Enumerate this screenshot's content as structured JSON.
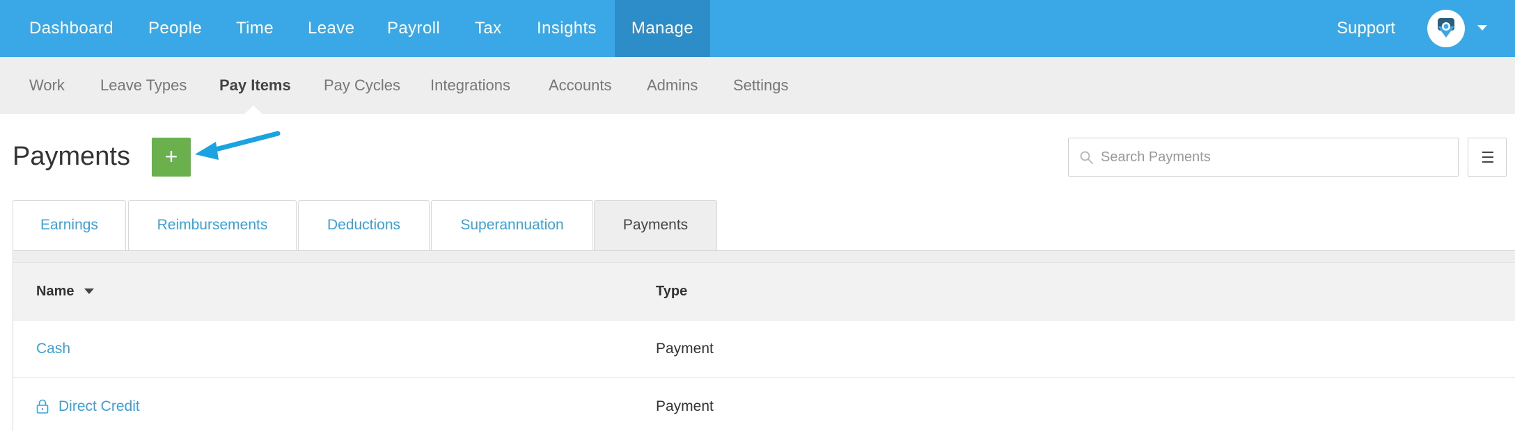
{
  "topnav": {
    "items": [
      "Dashboard",
      "People",
      "Time",
      "Leave",
      "Payroll",
      "Tax",
      "Insights",
      "Manage"
    ],
    "active": "Manage",
    "support": "Support"
  },
  "subnav": {
    "items": [
      "Work",
      "Leave Types",
      "Pay Items",
      "Pay Cycles",
      "Integrations",
      "Accounts",
      "Admins",
      "Settings"
    ],
    "active": "Pay Items"
  },
  "page": {
    "title": "Payments",
    "add_label": "+"
  },
  "search": {
    "placeholder": "Search Payments"
  },
  "tabs": {
    "items": [
      "Earnings",
      "Reimbursements",
      "Deductions",
      "Superannuation",
      "Payments"
    ],
    "active": "Payments"
  },
  "table": {
    "columns": [
      "Name",
      "Type"
    ],
    "rows": [
      {
        "name": "Cash",
        "type": "Payment",
        "locked": false
      },
      {
        "name": "Direct Credit",
        "type": "Payment",
        "locked": true
      }
    ]
  },
  "colors": {
    "topnav": "#3aa8e6",
    "topnav_active": "#2c8dc9",
    "add_button": "#6ab04c",
    "link": "#3aa0d8",
    "annotation_arrow": "#1aa3e0"
  },
  "icons": {
    "avatar": "avatar-logo-icon",
    "search": "search-icon",
    "menu": "hamburger-menu-icon",
    "sort": "sort-caret-icon",
    "lock": "lock-icon",
    "annotation": "arrow-annotation-icon"
  }
}
